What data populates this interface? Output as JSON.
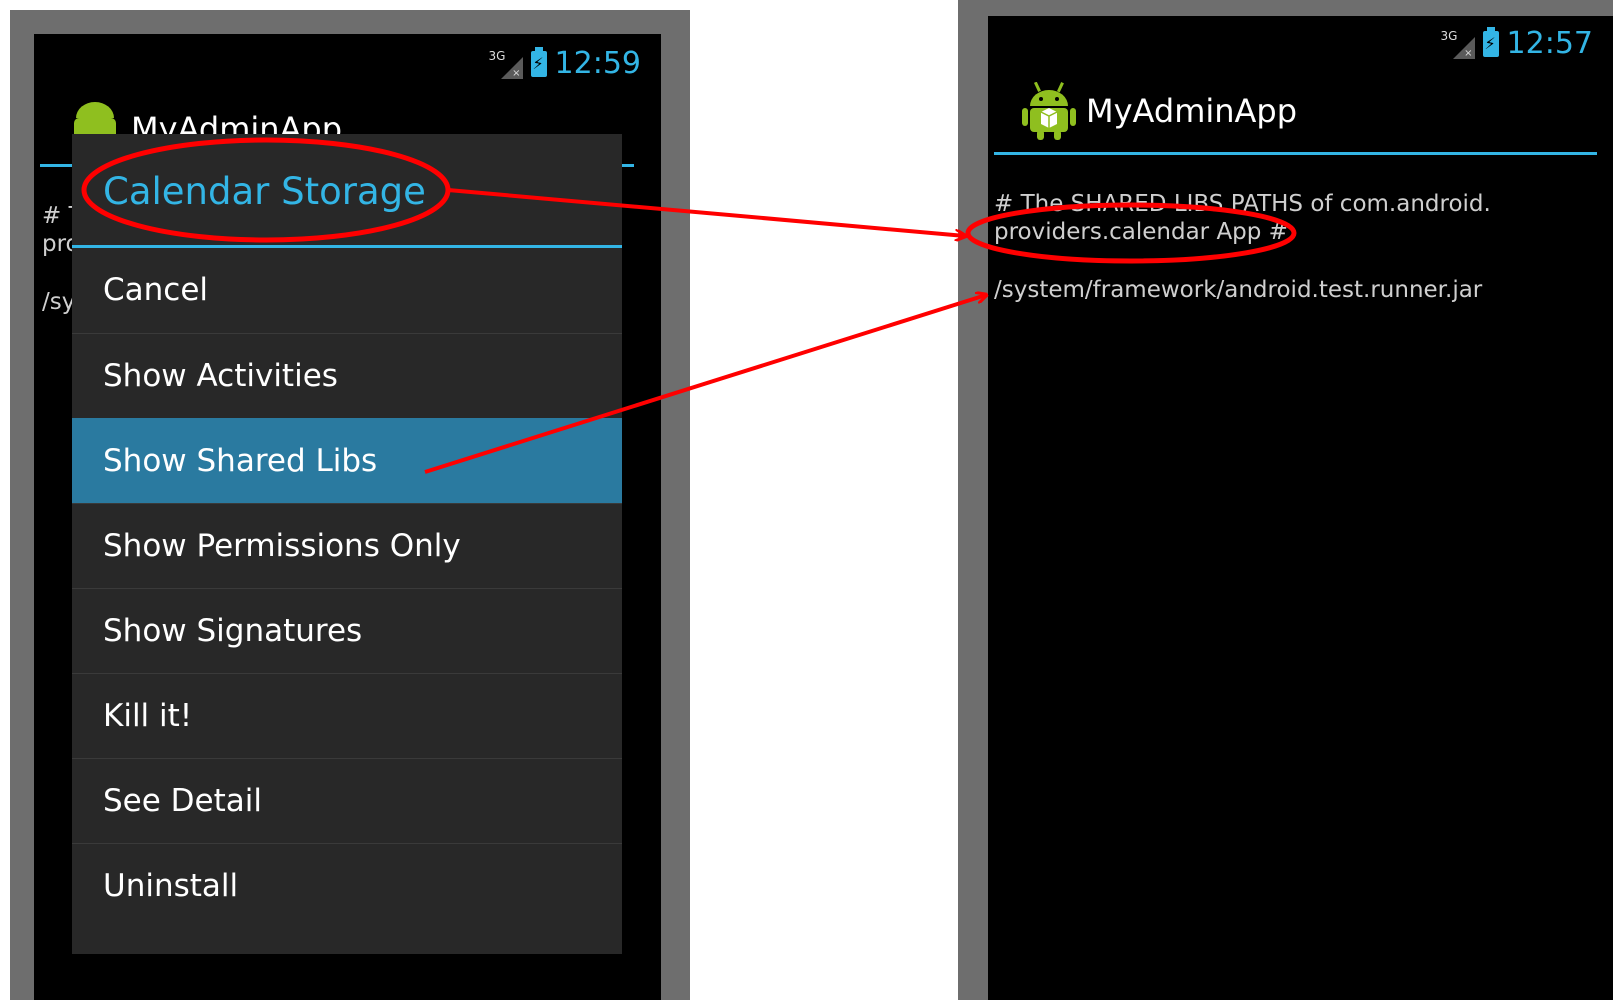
{
  "left_screen": {
    "status": {
      "network": "3G",
      "time": "12:59"
    },
    "app_title": "MyAdminApp",
    "background_text": [
      "# T",
      "pro",
      "/sy"
    ],
    "dialog": {
      "title": "Calendar Storage",
      "items": [
        {
          "label": "Cancel",
          "selected": false
        },
        {
          "label": "Show Activities",
          "selected": false
        },
        {
          "label": "Show Shared Libs",
          "selected": true
        },
        {
          "label": "Show Permissions Only",
          "selected": false
        },
        {
          "label": "Show Signatures",
          "selected": false
        },
        {
          "label": "Kill it!",
          "selected": false
        },
        {
          "label": "See Detail",
          "selected": false
        },
        {
          "label": "Uninstall",
          "selected": false
        }
      ]
    }
  },
  "right_screen": {
    "status": {
      "network": "3G",
      "time": "12:57"
    },
    "app_title": "MyAdminApp",
    "content": {
      "heading_line1": "# The SHARED LIBS PATHS of com.android.",
      "heading_line2": "providers.calendar App #",
      "path": "/system/framework/android.test.runner.jar"
    }
  },
  "colors": {
    "accent": "#33b5e5",
    "selected_item": "#2a7aa0",
    "annotation": "#ff0000",
    "dialog_bg": "#282828"
  },
  "icons": [
    "android-app-icon",
    "signal-3g-icon",
    "battery-charging-icon"
  ]
}
